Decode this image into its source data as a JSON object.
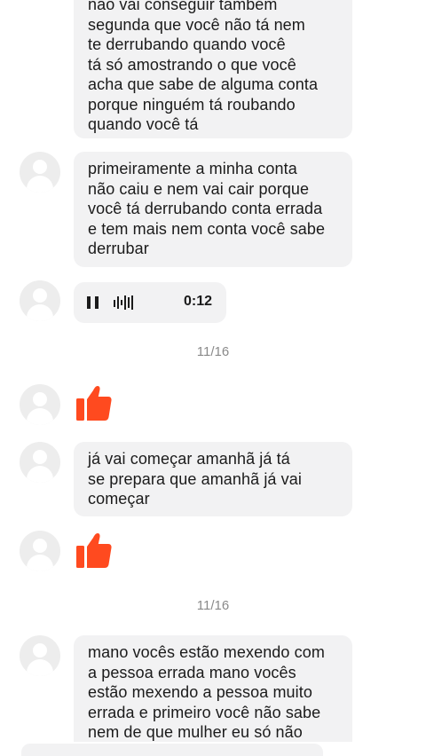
{
  "messages": [
    {
      "lines": [
        "não vai conseguir também",
        "segunda que você não tá nem",
        "te derrubando quando você",
        "tá só amostrando o que você",
        "acha que sabe de alguma conta",
        "porque ninguém tá roubando",
        "quando você tá"
      ]
    },
    {
      "lines": [
        "primeiramente a minha conta",
        "não caiu e nem vai cair porque",
        "você tá derrubando conta errada",
        "e tem mais nem conta você sabe",
        "derrubar"
      ]
    },
    {
      "lines": [
        "já vai começar amanhã já tá",
        "se prepara que amanhã já vai",
        "começar"
      ]
    },
    {
      "lines": [
        "mano vocês estão mexendo com",
        "a pessoa errada mano vocês",
        "estão mexendo a pessoa muito",
        "errada e primeiro você não sabe",
        "nem de que mulher eu só não"
      ]
    }
  ],
  "audio": {
    "duration": "0:12",
    "pause_icon": "pause-icon",
    "waveform_icon": "waveform-icon"
  },
  "dates": [
    "11/16",
    "11/16"
  ],
  "reactions": [
    "thumbs-up-icon",
    "thumbs-up-icon"
  ],
  "colors": {
    "bubble": "#f2f2f3",
    "thumb": "#ff4a1f",
    "date": "#8a8a8a"
  }
}
